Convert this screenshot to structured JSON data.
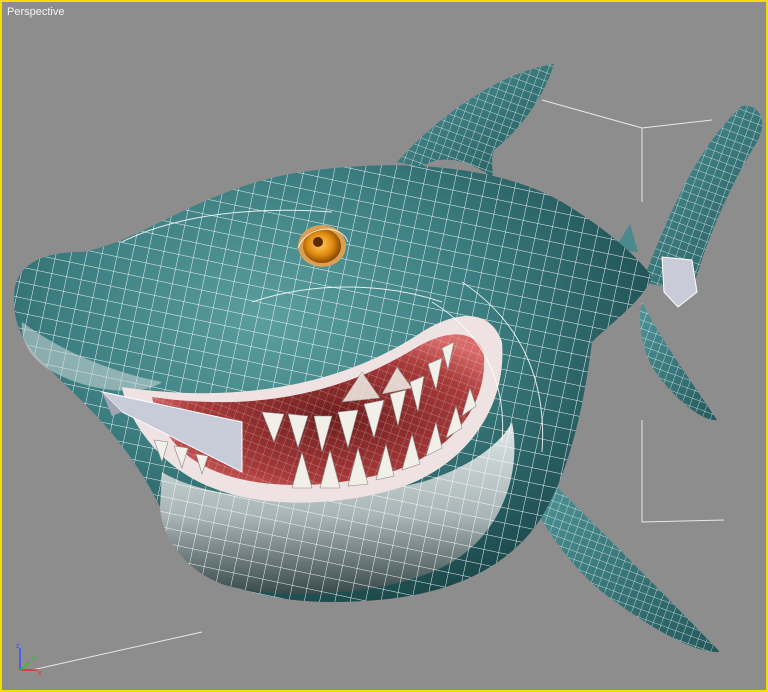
{
  "viewport": {
    "label": "Perspective",
    "border_color": "#f0e000",
    "background_color": "#8d8d8d"
  },
  "model": {
    "object": "shark",
    "body_color": "#3b7d80",
    "wireframe_color": "#ffffff",
    "eye_color": "#e08a10",
    "mouth_color": "#a83a3a",
    "tooth_color": "#f2efe8"
  },
  "gizmo": {
    "icon": "axis-tripod-icon",
    "axis_colors": {
      "x": "#e03030",
      "y": "#30c030",
      "z": "#3050ff"
    }
  }
}
